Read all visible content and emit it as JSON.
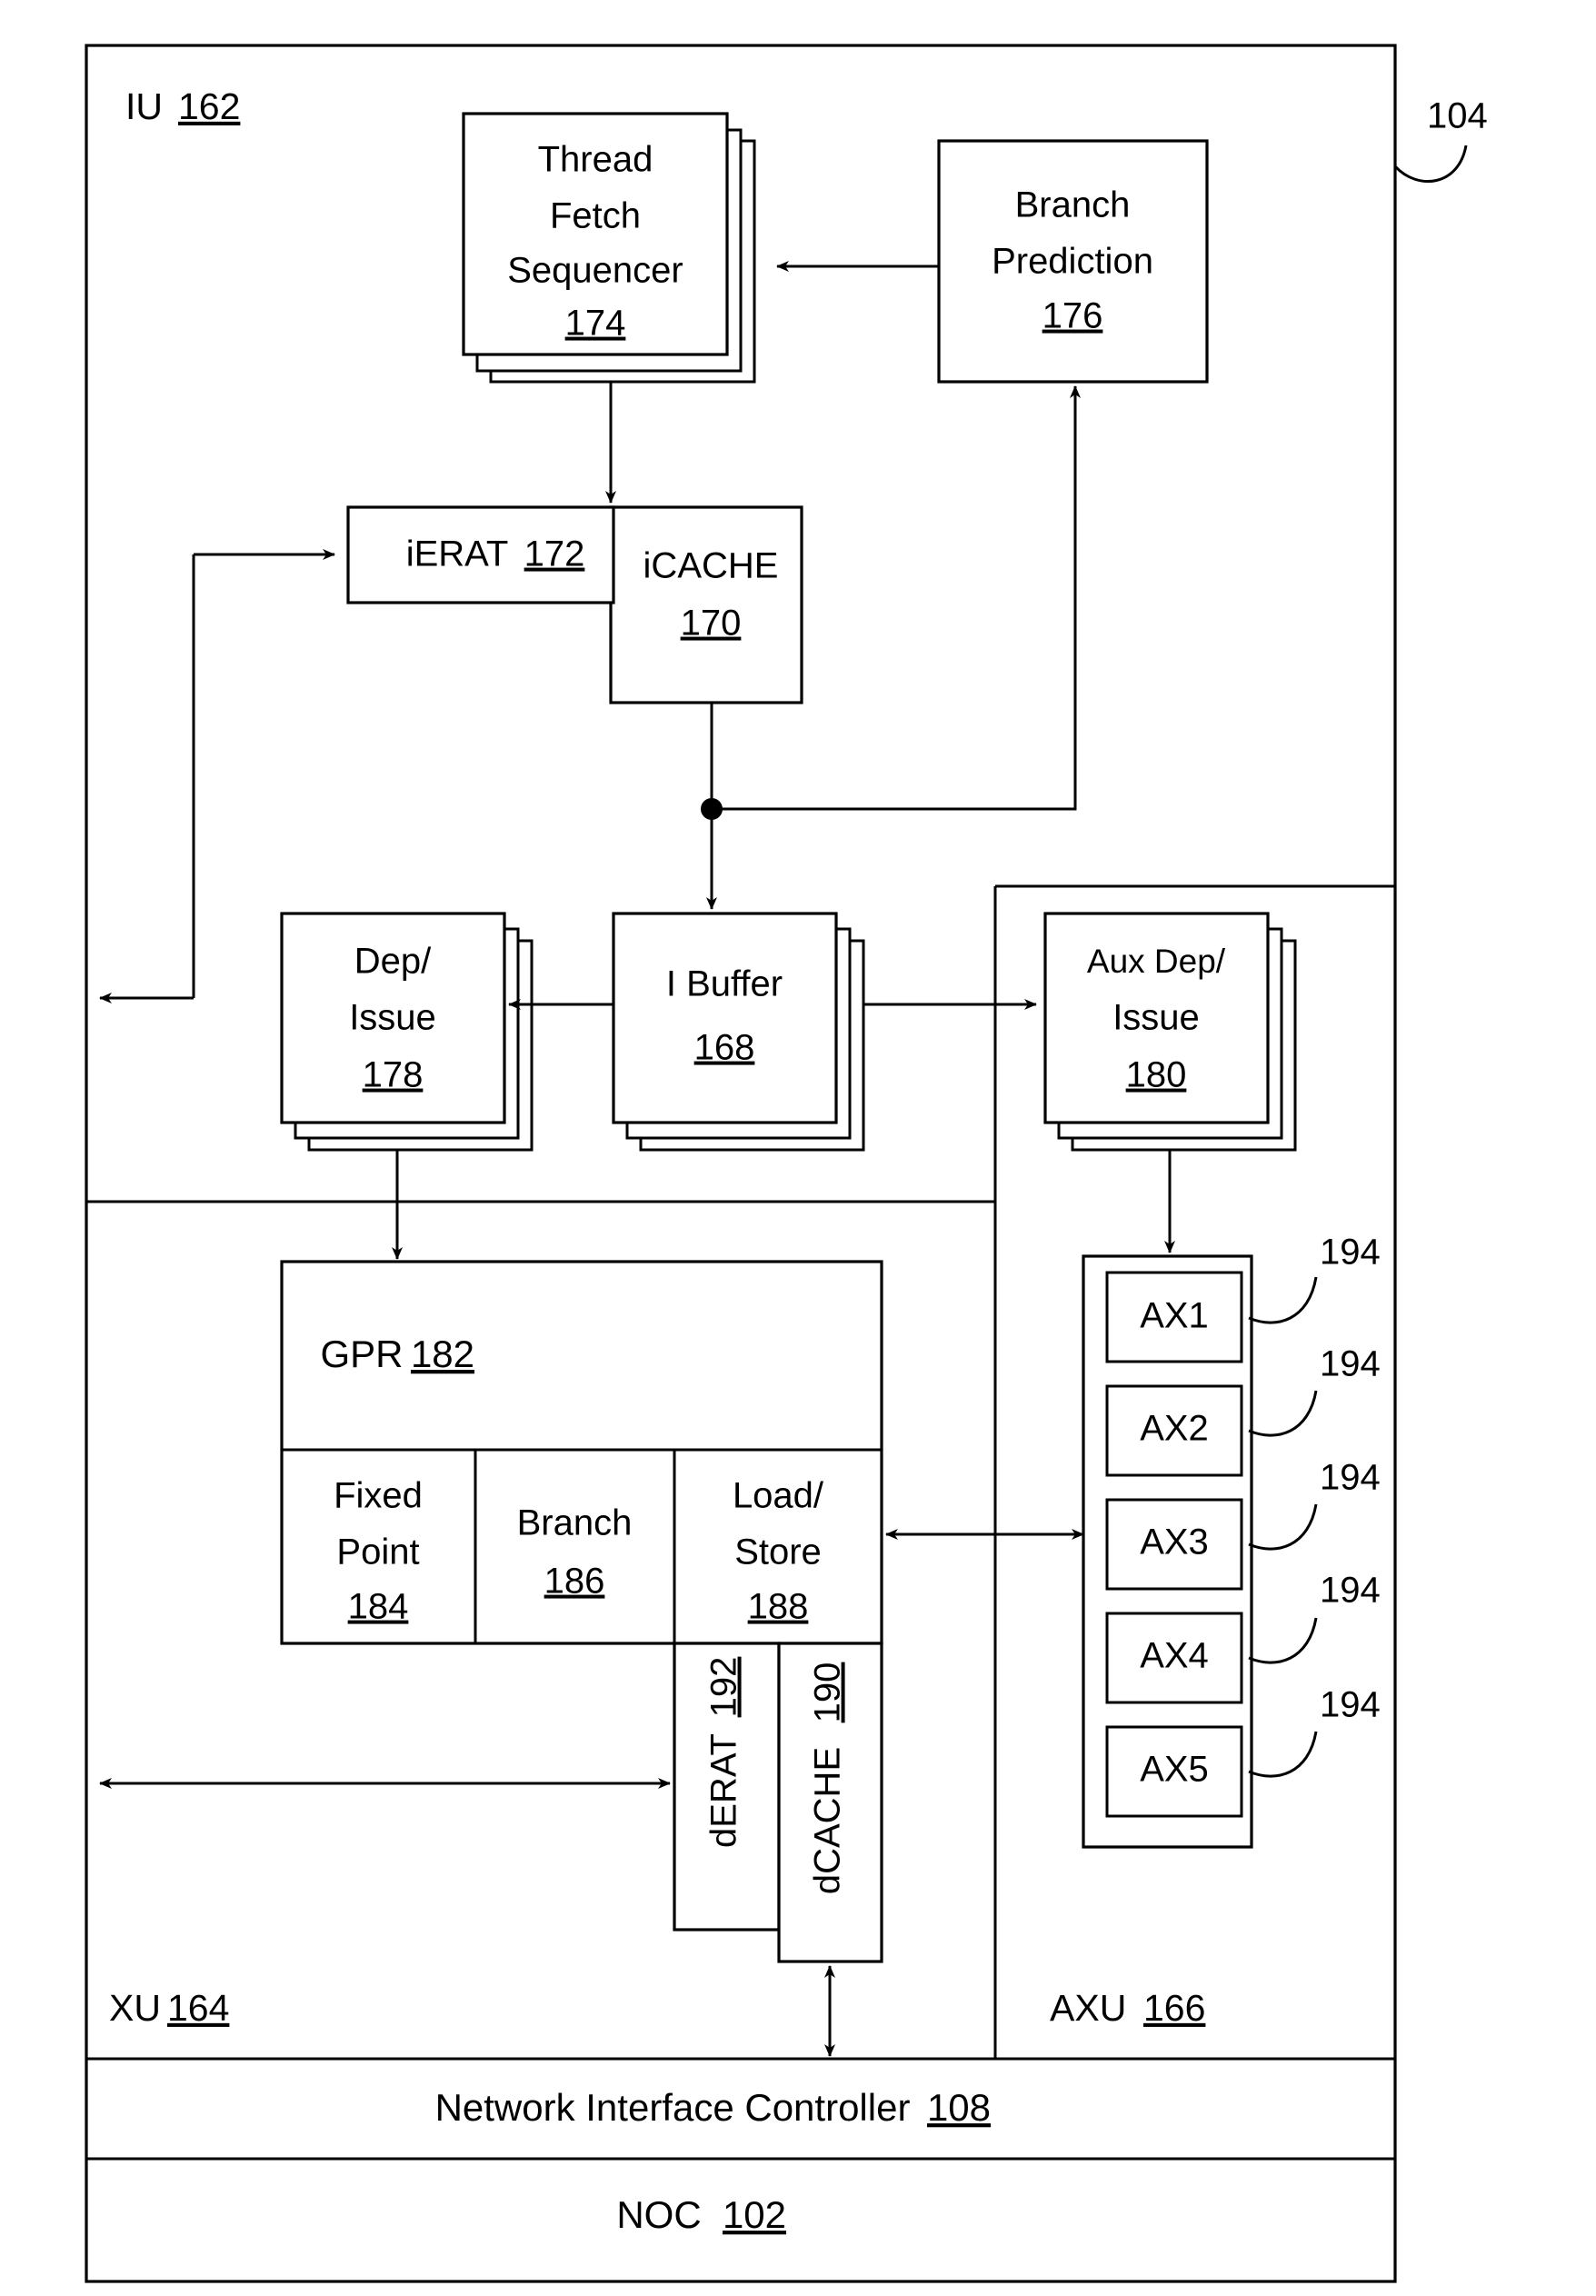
{
  "figure": {
    "ref_label": "104",
    "outer_units": {
      "iu": {
        "label": "IU",
        "ref": "162"
      },
      "xu": {
        "label": "XU",
        "ref": "164"
      },
      "axu": {
        "label": "AXU",
        "ref": "166"
      }
    },
    "bottom_bars": [
      {
        "label": "Network Interface Controller",
        "ref": "108"
      },
      {
        "label": "NOC",
        "ref": "102"
      }
    ]
  },
  "blocks": {
    "thread_fetch_sequencer": {
      "line1": "Thread",
      "line2": "Fetch",
      "line3": "Sequencer",
      "ref": "174",
      "stacked": true
    },
    "branch_prediction": {
      "line1": "Branch",
      "line2": "Prediction",
      "ref": "176",
      "stacked": false
    },
    "ierat": {
      "label": "iERAT",
      "ref": "172"
    },
    "icache": {
      "line1": "iCACHE",
      "ref": "170"
    },
    "dep_issue": {
      "line1": "Dep/",
      "line2": "Issue",
      "ref": "178",
      "stacked": true
    },
    "i_buffer": {
      "line1": "I Buffer",
      "ref": "168",
      "stacked": true
    },
    "aux_dep_issue": {
      "line1": "Aux Dep/",
      "line2": "Issue",
      "ref": "180",
      "stacked": true
    },
    "gpr": {
      "label": "GPR",
      "ref": "182"
    },
    "fixed_point": {
      "line1": "Fixed",
      "line2": "Point",
      "ref": "184"
    },
    "branch": {
      "line1": "Branch",
      "ref": "186"
    },
    "load_store": {
      "line1": "Load/",
      "line2": "Store",
      "ref": "188"
    },
    "derat": {
      "label": "dERAT",
      "ref": "192",
      "rotated": true
    },
    "dcache": {
      "label": "dCACHE",
      "ref": "190",
      "rotated": true
    }
  },
  "aux_units": {
    "ref_label": "194",
    "items": [
      {
        "label": "AX1",
        "ref": "194"
      },
      {
        "label": "AX2",
        "ref": "194"
      },
      {
        "label": "AX3",
        "ref": "194"
      },
      {
        "label": "AX4",
        "ref": "194"
      },
      {
        "label": "AX5",
        "ref": "194"
      }
    ]
  },
  "colors": {
    "stroke": "#000000",
    "fill": "#ffffff"
  }
}
